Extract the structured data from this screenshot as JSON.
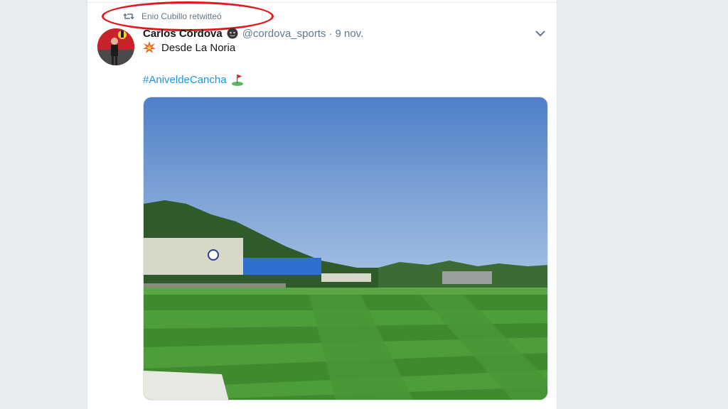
{
  "retweet_context": {
    "text": "Enio Cubillo retwitteó",
    "icon": "retweet-icon"
  },
  "tweet": {
    "display_name": "Carlos Córdova",
    "handle": "@cordova_sports",
    "separator": "·",
    "timestamp": "9 nov.",
    "text_line_1": "Desde La Noria",
    "hashtag": "#AniveldeCancha",
    "emojis": [
      "collision-emoji",
      "golf-flag-emoji"
    ],
    "media": {
      "description_icon": "photo-soccer-field"
    }
  },
  "colors": {
    "background": "#e6ecf0",
    "card": "#ffffff",
    "link": "#1b95e0",
    "secondary_text": "#657786",
    "primary_text": "#14171a",
    "highlight": "#e8141c"
  }
}
